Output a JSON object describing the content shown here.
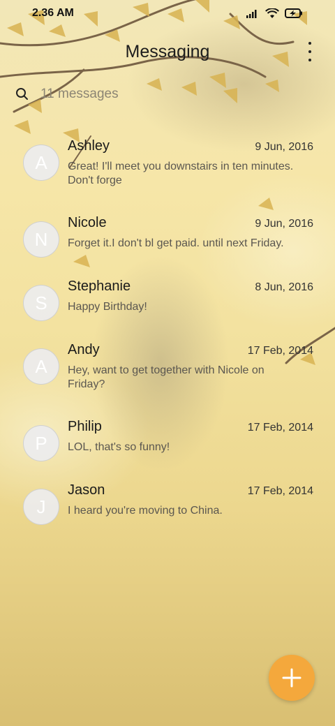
{
  "status_bar": {
    "time": "2.36 AM",
    "icons": [
      "signal-icon",
      "wifi-icon",
      "battery-charging-icon"
    ]
  },
  "header": {
    "title": "Messaging",
    "menu_icon": "more-vert-icon"
  },
  "search": {
    "icon": "search-icon",
    "placeholder": "11 messages"
  },
  "conversations": [
    {
      "initial": "A",
      "name": "Ashley",
      "date": "9 Jun, 2016",
      "snippet": "Great! I'll meet you downstairs in ten minutes. Don't forge"
    },
    {
      "initial": "N",
      "name": "Nicole",
      "date": "9 Jun, 2016",
      "snippet": "Forget it.I don't bl get paid. until next Friday."
    },
    {
      "initial": "S",
      "name": "Stephanie",
      "date": "8 Jun, 2016",
      "snippet": "Happy Birthday!"
    },
    {
      "initial": "A",
      "name": "Andy",
      "date": "17 Feb, 2014",
      "snippet": "Hey, want to get together with Nicole on Friday?"
    },
    {
      "initial": "P",
      "name": "Philip",
      "date": "17 Feb, 2014",
      "snippet": "LOL, that's so funny!"
    },
    {
      "initial": "J",
      "name": "Jason",
      "date": "17 Feb, 2014",
      "snippet": "I heard you're moving to China."
    }
  ],
  "fab": {
    "icon": "plus-icon",
    "color": "#f4a83c"
  }
}
